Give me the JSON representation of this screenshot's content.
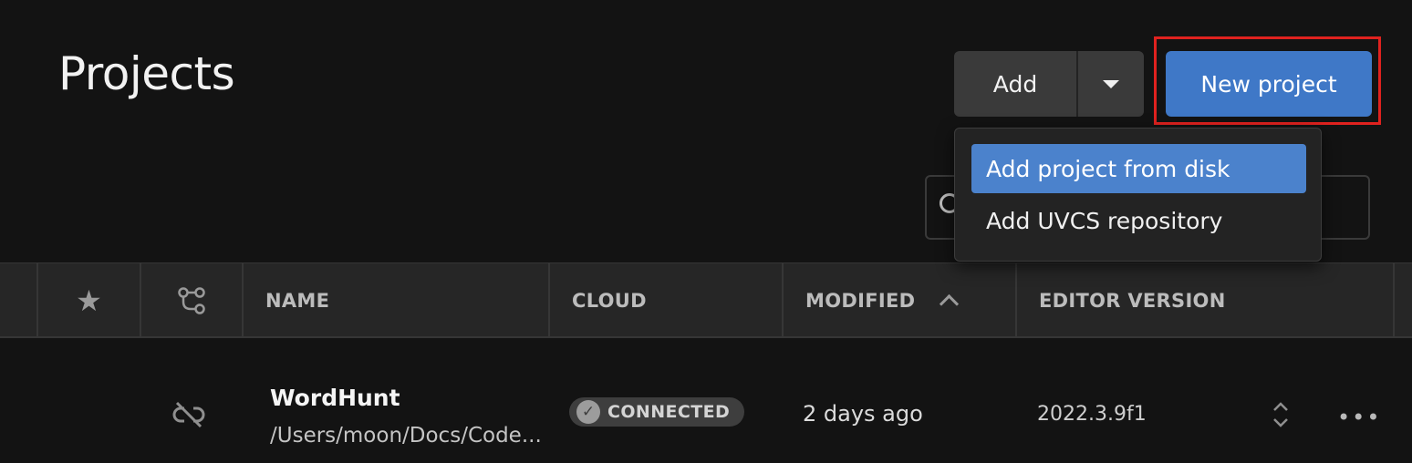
{
  "page": {
    "title": "Projects"
  },
  "toolbar": {
    "add_label": "Add",
    "new_project_label": "New project"
  },
  "add_menu": {
    "items": [
      {
        "label": "Add project from disk",
        "active": true
      },
      {
        "label": "Add UVCS repository",
        "active": false
      }
    ]
  },
  "table": {
    "columns": {
      "favorite_icon": "star-icon",
      "vcs_icon": "branch-icon",
      "name": "NAME",
      "cloud": "CLOUD",
      "modified": "MODIFIED",
      "editor_version": "EDITOR VERSION"
    },
    "sort": {
      "column": "modified",
      "direction": "ascending"
    },
    "rows": [
      {
        "name": "WordHunt",
        "path": "/Users/moon/Docs/Code...",
        "cloud_status": "CONNECTED",
        "modified": "2 days ago",
        "editor_version": "2022.3.9f1"
      }
    ]
  },
  "colors": {
    "background": "#131313",
    "primary_button": "#3f78c7",
    "menu_active": "#4b82cc",
    "annotation_red": "#e0221f"
  }
}
